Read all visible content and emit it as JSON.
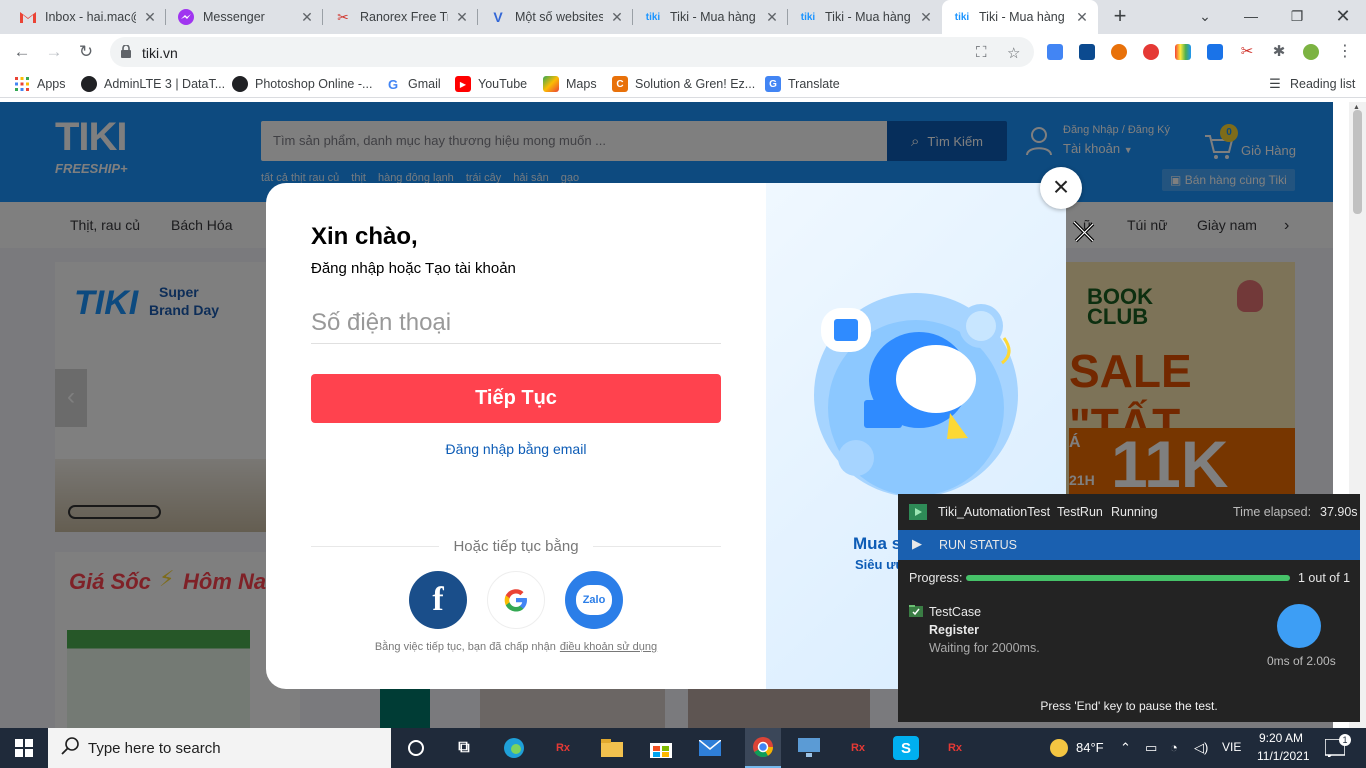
{
  "browser": {
    "tabs": [
      {
        "title": "Inbox - hai.mac@",
        "icon": "gmail-icon"
      },
      {
        "title": "Messenger",
        "icon": "messenger-icon"
      },
      {
        "title": "Ranorex Free Tria",
        "icon": "ranorex-icon"
      },
      {
        "title": "Một số websites",
        "icon": "v-icon"
      },
      {
        "title": "Tiki - Mua hàng c",
        "icon": "tiki-icon"
      },
      {
        "title": "Tiki - Mua hàng c",
        "icon": "tiki-icon"
      },
      {
        "title": "Tiki - Mua hàng c",
        "icon": "tiki-icon"
      }
    ],
    "url": "tiki.vn",
    "bookmarks": [
      {
        "label": "Apps",
        "icon": "apps-grid-icon"
      },
      {
        "label": "AdminLTE 3 | DataT...",
        "icon": "web-icon"
      },
      {
        "label": "Photoshop Online -...",
        "icon": "web-icon"
      },
      {
        "label": "Gmail",
        "icon": "google-icon"
      },
      {
        "label": "YouTube",
        "icon": "youtube-icon"
      },
      {
        "label": "Maps",
        "icon": "maps-icon"
      },
      {
        "label": "Solution & Gren! Ez...",
        "icon": "solution-icon"
      },
      {
        "label": "Translate",
        "icon": "translate-icon"
      }
    ],
    "reading_list": "Reading list"
  },
  "tiki": {
    "logo_text": "TIKI",
    "freeship": "FREESHIP+",
    "search_placeholder": "Tìm sản phẩm, danh mục hay thương hiệu mong muốn ...",
    "search_button": "Tìm Kiếm",
    "quick_links": [
      "tất cả thịt rau củ",
      "thịt",
      "hàng đông lạnh",
      "trái cây",
      "hải sản",
      "gạo"
    ],
    "account_line1": "Đăng Nhập / Đăng Ký",
    "account_line2": "Tài khoản",
    "cart_count": "0",
    "cart_label": "Giỏ Hàng",
    "sell_label": "Bán hàng cùng Tiki",
    "categories": [
      "Thịt, rau củ",
      "Bách Hóa",
      "ữ",
      "Túi nữ",
      "Giày nam"
    ],
    "superbrand": "TIKI",
    "superbrand_sub1": "Super",
    "superbrand_sub2": "Brand Day",
    "sale_title": "Giá Sốc",
    "sale_title2": "Hôm Na",
    "book_club_1": "BOOK",
    "book_club_2": "CLUB",
    "banner_sale": "SALE \"TẤT",
    "banner_price": "11K",
    "banner_small1": "Á",
    "banner_small2": "21H"
  },
  "modal": {
    "greeting": "Xin chào,",
    "subtitle": "Đăng nhập hoặc Tạo tài khoản",
    "phone_placeholder": "Số điện thoại",
    "continue_label": "Tiếp Tục",
    "email_link": "Đăng nhập bằng email",
    "or_label": "Hoặc tiếp tục bằng",
    "terms_text": "Bằng việc tiếp tục, bạn đã chấp nhận",
    "terms_link": "điều khoản sử dụng",
    "right_title": "Mua s",
    "right_sub": "Siêu ưu",
    "zalo_label": "Zalo",
    "facebook_label": "f"
  },
  "ranorex": {
    "project": "Tiki_AutomationTest",
    "run": "TestRun",
    "state": "Running",
    "elapsed_label": "Time elapsed:",
    "elapsed_value": "37.90s",
    "run_status": "RUN STATUS",
    "progress_label": "Progress:",
    "progress_fraction": 1.0,
    "progress_text": "1 out of 1",
    "testcase_label": "TestCase",
    "testcase_name": "Register",
    "testcase_status": "Waiting for 2000ms.",
    "timer": "0ms of 2.00s",
    "footer": "Press 'End' key to pause the test."
  },
  "taskbar": {
    "search_placeholder": "Type here to search",
    "weather": "84°F",
    "language": "VIE",
    "time": "9:20 AM",
    "date": "11/1/2021",
    "notifications": "1"
  },
  "colors": {
    "tiki_blue": "#1a94ff",
    "tiki_dark_blue": "#0d5cb6",
    "continue_red": "#ff424e",
    "ranorex_status_blue": "#1a60b0",
    "progress_green": "#46c269"
  }
}
